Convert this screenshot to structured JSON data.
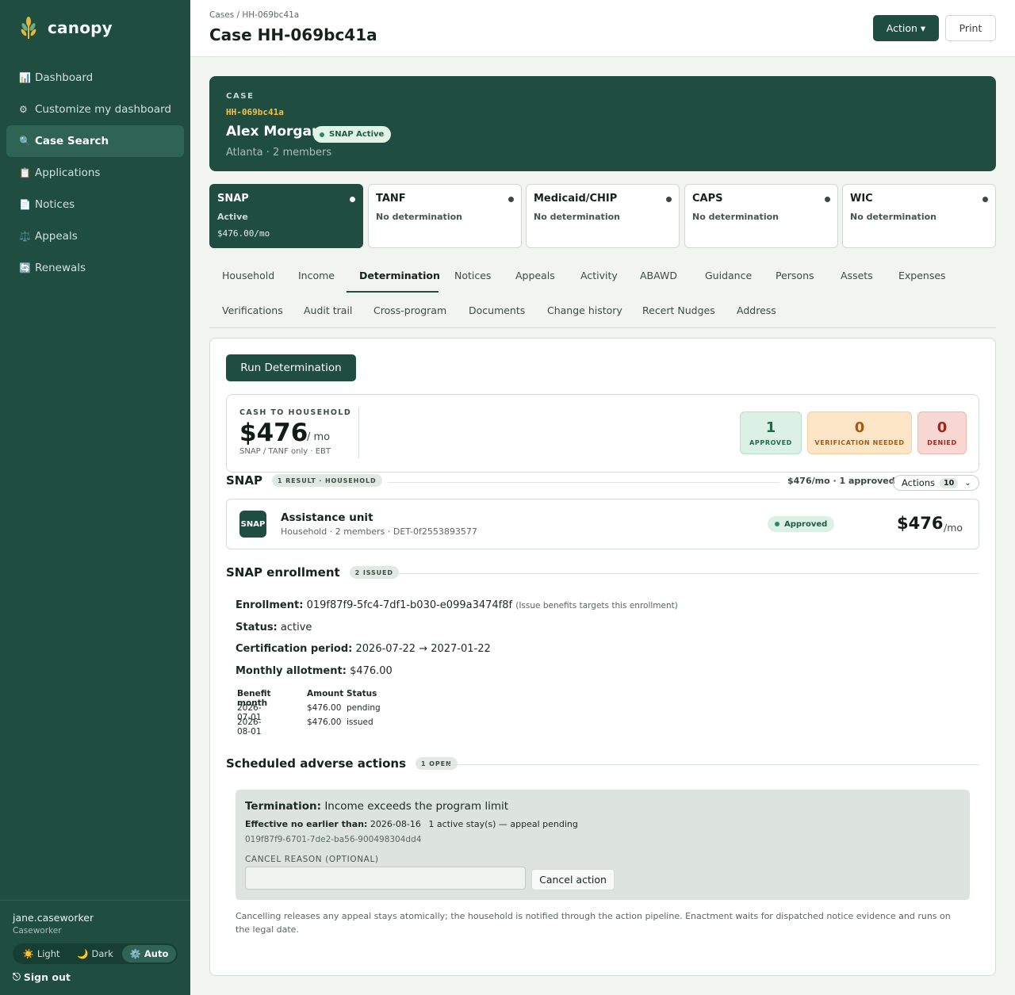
{
  "brand": {
    "name": "canopy"
  },
  "nav": [
    {
      "icon": "📊",
      "label": "Dashboard",
      "active": false,
      "name": "dashboard"
    },
    {
      "icon": "⚙",
      "label": "Customize my dashboard",
      "active": false,
      "name": "customize"
    },
    {
      "icon": "🔍",
      "label": "Case Search",
      "active": true,
      "name": "case-search"
    },
    {
      "icon": "📋",
      "label": "Applications",
      "active": false,
      "name": "applications"
    },
    {
      "icon": "📄",
      "label": "Notices",
      "active": false,
      "name": "notices"
    },
    {
      "icon": "⚖️",
      "label": "Appeals",
      "active": false,
      "name": "appeals"
    },
    {
      "icon": "🔄",
      "label": "Renewals",
      "active": false,
      "name": "renewals"
    }
  ],
  "user": {
    "name": "jane.caseworker",
    "role": "Caseworker"
  },
  "theme": {
    "light": "Light",
    "dark": "Dark",
    "auto": "Auto",
    "selected": "Auto"
  },
  "signout": "Sign out",
  "header": {
    "breadcrumb": "Cases / HH-069bc41a",
    "title": "Case HH-069bc41a",
    "action_label": "Action ▾",
    "print_label": "Print"
  },
  "case": {
    "eyebrow": "CASE",
    "id": "HH-069bc41a",
    "name": "Alex Morgan",
    "badge": "SNAP Active",
    "sub": "Atlanta · 2 members"
  },
  "programs": [
    {
      "name": "SNAP",
      "status": "Active",
      "amount": "$476.00/mo",
      "active": true
    },
    {
      "name": "TANF",
      "status": "No determination",
      "amount": "",
      "active": false
    },
    {
      "name": "Medicaid/CHIP",
      "status": "No determination",
      "amount": "",
      "active": false
    },
    {
      "name": "CAPS",
      "status": "No determination",
      "amount": "",
      "active": false
    },
    {
      "name": "WIC",
      "status": "No determination",
      "amount": "",
      "active": false
    }
  ],
  "tabs": {
    "row1": [
      "Household",
      "Income",
      "Determination",
      "Notices",
      "Appeals",
      "Activity",
      "ABAWD",
      "Guidance",
      "Persons",
      "Assets",
      "Expenses"
    ],
    "row2": [
      "Verifications",
      "Audit trail",
      "Cross-program",
      "Documents",
      "Change history",
      "Recert Nudges",
      "Address"
    ],
    "active": "Determination"
  },
  "determination": {
    "run_label": "Run Determination",
    "cash": {
      "eyebrow": "CASH TO HOUSEHOLD",
      "amount": "$476",
      "unit": "/ mo",
      "note": "SNAP / TANF only · EBT"
    },
    "stats": {
      "approved": {
        "value": "1",
        "label": "APPROVED"
      },
      "verification": {
        "value": "0",
        "label": "VERIFICATION NEEDED"
      },
      "denied": {
        "value": "0",
        "label": "DENIED"
      }
    },
    "snap": {
      "title": "SNAP",
      "pill": "1 RESULT · HOUSEHOLD",
      "meta": "$476/mo · 1 approved",
      "actions_label": "Actions",
      "actions_count": "10",
      "unit": {
        "icon": "SNAP",
        "title": "Assistance unit",
        "sub": "Household · 2 members · DET-0f2553893577",
        "badge": "Approved",
        "amount": "$476",
        "per": "/mo"
      }
    },
    "enrollment": {
      "title": "SNAP enrollment",
      "pill": "2 ISSUED",
      "enrollment_label": "Enrollment:",
      "enrollment_value": "019f87f9-5fc4-7df1-b030-e099a3474f8f",
      "enrollment_note": "(Issue benefits targets this enrollment)",
      "status_label": "Status:",
      "status_value": "active",
      "cert_label": "Certification period:",
      "cert_value": "2026-07-22 → 2027-01-22",
      "allot_label": "Monthly allotment:",
      "allot_value": "$476.00",
      "table": {
        "headers": [
          "Benefit month",
          "Amount",
          "Status"
        ],
        "rows": [
          [
            "2026-07-01",
            "$476.00",
            "pending"
          ],
          [
            "2026-08-01",
            "$476.00",
            "issued"
          ]
        ]
      }
    },
    "adverse": {
      "title": "Scheduled adverse actions",
      "pill": "1 OPEN",
      "term_label": "Termination:",
      "term_value": "Income exceeds the program limit",
      "eff_label": "Effective no earlier than:",
      "eff_value": "2026-08-16",
      "stay_note": "1 active stay(s) — appeal pending",
      "action_id": "019f87f9-6701-7de2-ba56-900498304dd4",
      "reason_label": "CANCEL REASON (OPTIONAL)",
      "reason_value": "",
      "cancel_label": "Cancel action",
      "help": "Cancelling releases any appeal stays atomically; the household is notified through the action pipeline. Enactment waits for dispatched notice evidence and runs on the legal date."
    }
  }
}
